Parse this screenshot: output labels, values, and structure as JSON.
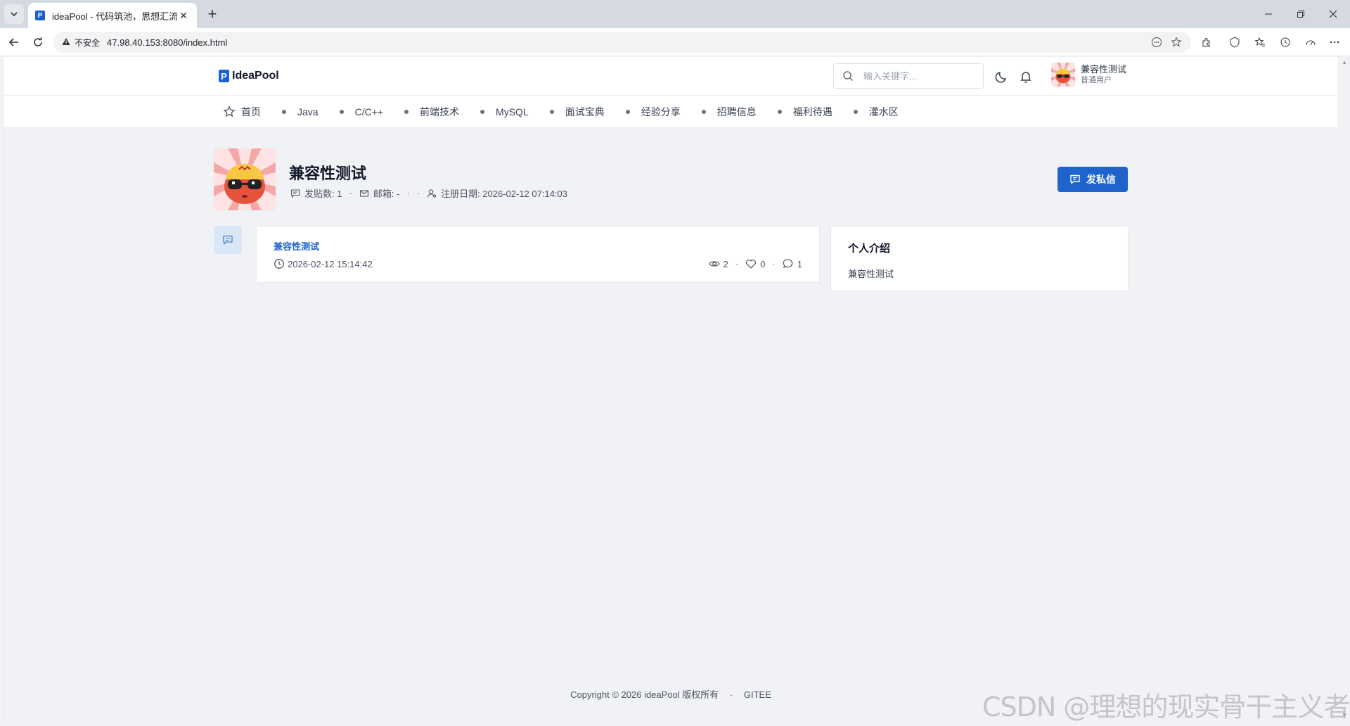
{
  "browser": {
    "tab_title": "ideaPool - 代码筑池，思想汇流",
    "tab_close": "✕",
    "new_tab": "+",
    "security_label": "不安全",
    "url": "47.98.40.153:8080/index.html"
  },
  "header": {
    "logo_mark": "P",
    "logo_text": "IdeaPool",
    "search_placeholder": "输入关键字...",
    "user_name": "兼容性测试",
    "user_role": "普通用户"
  },
  "nav": {
    "items": [
      {
        "label": "首页",
        "icon": "star-icon"
      },
      {
        "label": "Java",
        "icon": "dot"
      },
      {
        "label": "C/C++",
        "icon": "dot"
      },
      {
        "label": "前端技术",
        "icon": "dot"
      },
      {
        "label": "MySQL",
        "icon": "dot"
      },
      {
        "label": "面试宝典",
        "icon": "dot"
      },
      {
        "label": "经验分享",
        "icon": "dot"
      },
      {
        "label": "招聘信息",
        "icon": "dot"
      },
      {
        "label": "福利待遇",
        "icon": "dot"
      },
      {
        "label": "灌水区",
        "icon": "dot"
      }
    ]
  },
  "profile": {
    "name": "兼容性测试",
    "post_count": "发贴数: 1",
    "email": "邮箱: -",
    "sep": "·",
    "register_date": "注册日期: 2026-02-12 07:14:03",
    "message_button": "发私信"
  },
  "posts": [
    {
      "title": "兼容性测试",
      "time": "2026-02-12 15:14:42",
      "views": "2",
      "likes": "0",
      "comments": "1"
    }
  ],
  "intro": {
    "title": "个人介绍",
    "body": "兼容性测试"
  },
  "footer": {
    "copyright": "Copyright © 2026 ideaPool 版权所有",
    "sep": "·",
    "link": "GITEE"
  },
  "watermark": "CSDN @理想的现实骨干主义者",
  "colors": {
    "accent": "#1f64cc",
    "page_bg": "#f0f2f6",
    "card_bg": "#ffffff"
  }
}
